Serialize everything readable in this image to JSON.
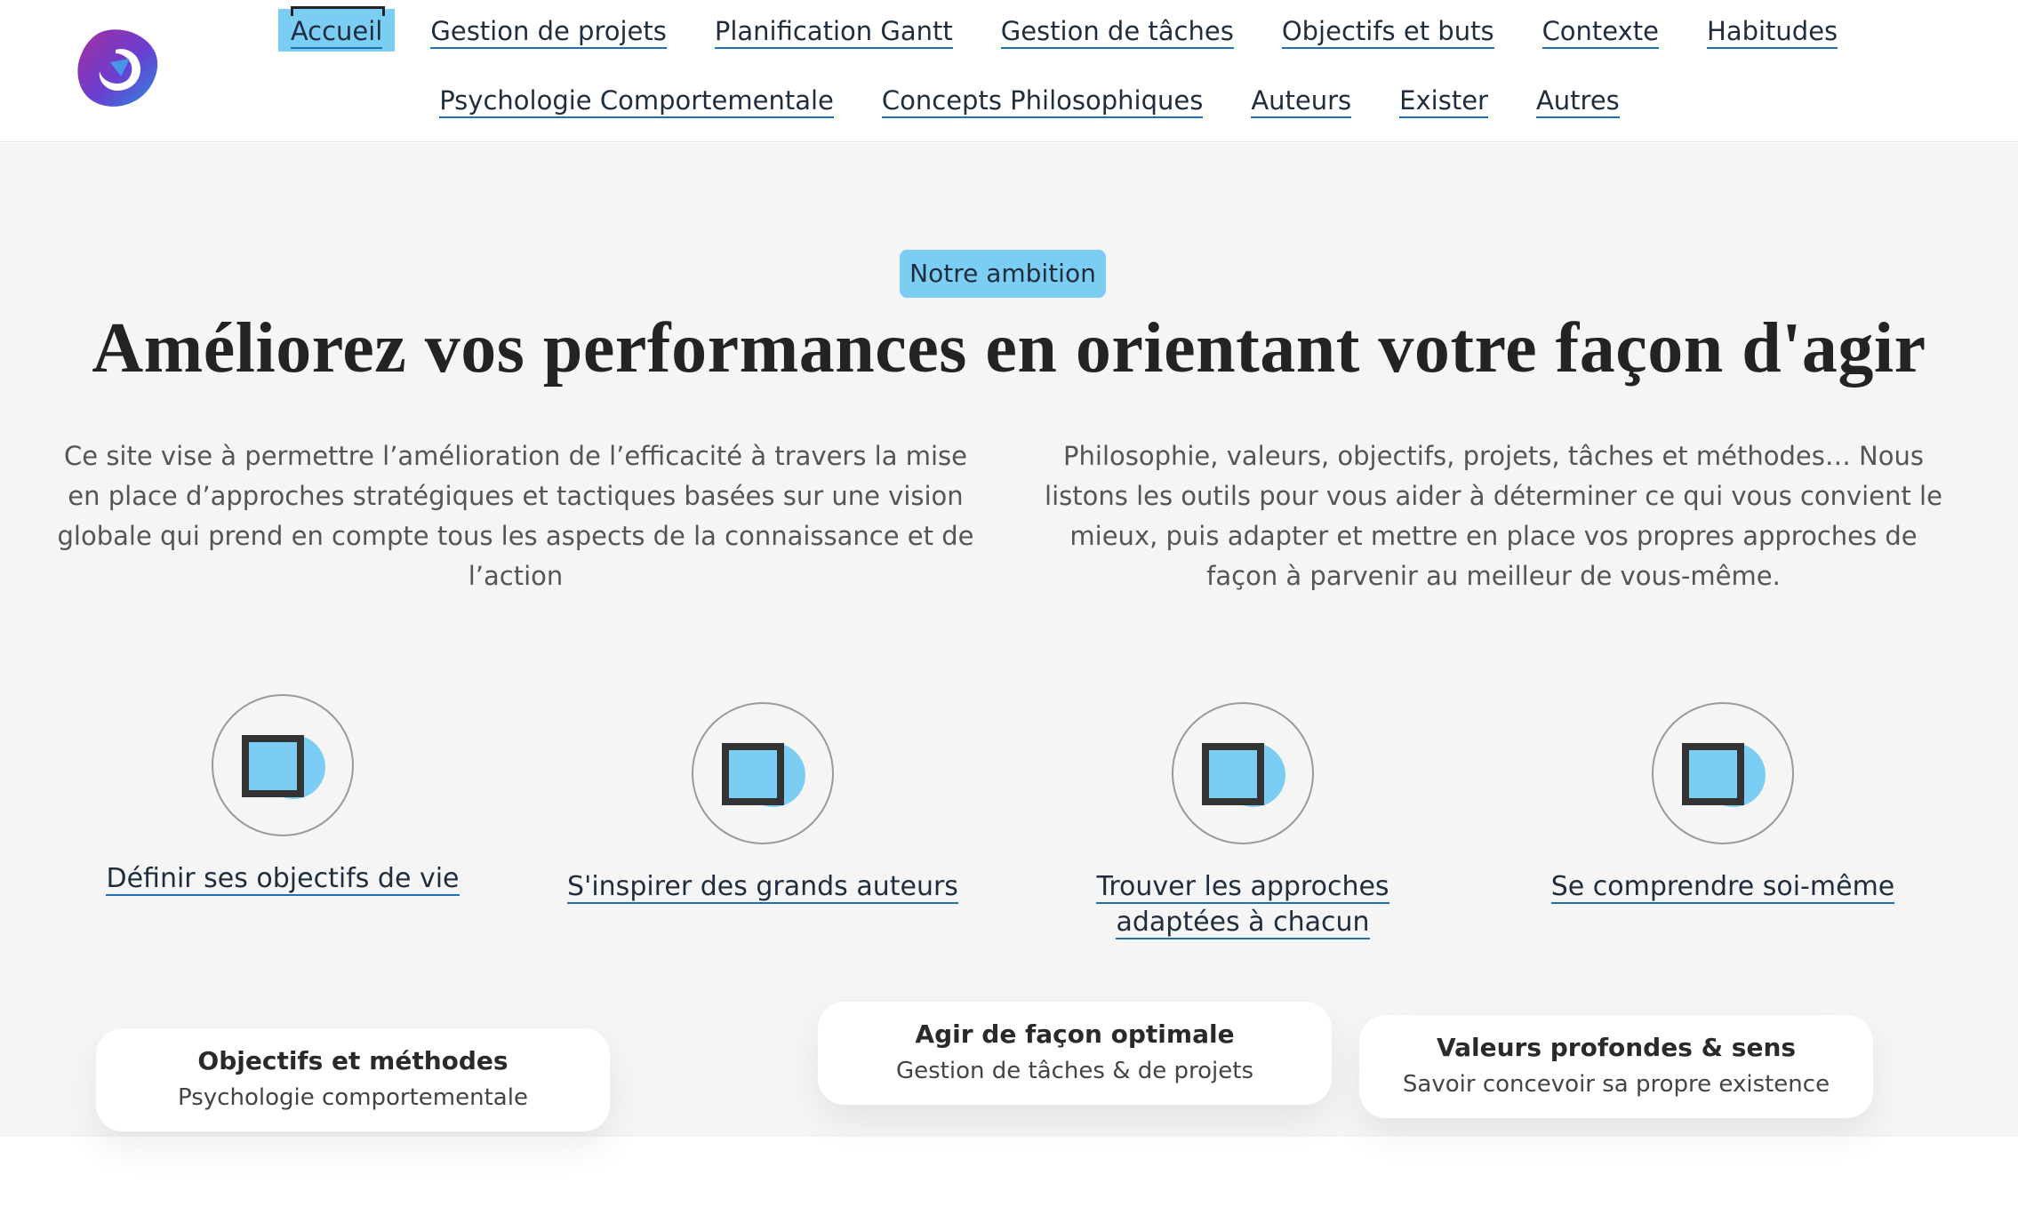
{
  "nav": {
    "row1": [
      {
        "label": "Accueil",
        "active": true
      },
      {
        "label": "Gestion de projets"
      },
      {
        "label": "Planification Gantt"
      },
      {
        "label": "Gestion de tâches"
      },
      {
        "label": "Objectifs et buts"
      },
      {
        "label": "Contexte"
      },
      {
        "label": "Habitudes"
      }
    ],
    "row2": [
      {
        "label": "Psychologie Comportementale"
      },
      {
        "label": "Concepts Philosophiques"
      },
      {
        "label": "Auteurs"
      },
      {
        "label": "Exister"
      },
      {
        "label": "Autres"
      }
    ]
  },
  "hero": {
    "badge": "Notre ambition",
    "title": "Améliorez vos performances en orientant votre façon d'agir",
    "intro_left": "Ce site vise à permettre l’amélioration de l’efficacité à travers la mise en place d’approches stratégiques et tactiques basées sur une vision globale qui prend en compte tous les aspects de la connaissance et de l’action",
    "intro_right": "Philosophie, valeurs, objectifs, projets, tâches et méthodes… Nous listons les outils pour vous aider à déterminer ce qui vous convient le mieux, puis adapter et mettre en place vos propres approches de façon à parvenir au meilleur de vous-même."
  },
  "features": [
    {
      "label": "Définir ses objectifs de vie"
    },
    {
      "label": "S'inspirer des grands auteurs"
    },
    {
      "label": "Trouver les approches adaptées à chacun"
    },
    {
      "label": "Se comprendre soi-même"
    }
  ],
  "cards": [
    {
      "title": "Objectifs et méthodes",
      "subtitle": "Psychologie comportementale"
    },
    {
      "title": "Agir de façon optimale",
      "subtitle": "Gestion de tâches & de projets"
    },
    {
      "title": "Valeurs profondes & sens",
      "subtitle": "Savoir concevoir sa propre existence"
    }
  ],
  "colors": {
    "accent": "#7ccdf3",
    "link_underline": "#1f6fb8",
    "hero_bg": "#f5f5f5",
    "logo_purple": "#8a2fa8",
    "logo_blue": "#2f7fd8"
  },
  "icons": [
    "site-logo",
    "square-icon"
  ]
}
